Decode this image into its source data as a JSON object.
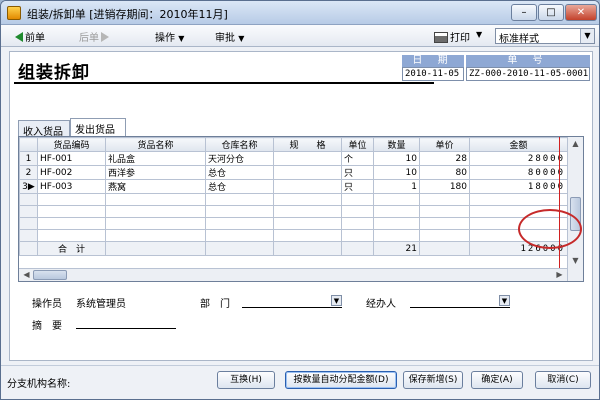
{
  "window": {
    "title": "组装/拆卸单 [进销存期间：2010年11月]",
    "min_label": "–",
    "max_label": "□",
    "close_label": "✕"
  },
  "toolbar": {
    "prev_label": "前单",
    "next_label": "后单",
    "operate_label": "操作",
    "approve_label": "审批",
    "print_label": "打印",
    "mode_value": "标准样式"
  },
  "doc": {
    "title": "组装拆卸",
    "date_label": "日 期",
    "date_value": "2010-11-05",
    "number_label": "单 号",
    "number_value": "ZZ-000-2010-11-05-0001"
  },
  "tabs": [
    {
      "label": "收入货品"
    },
    {
      "label": "发出货品"
    }
  ],
  "grid": {
    "columns": [
      "货品编码",
      "货品名称",
      "仓库名称",
      "规　　格",
      "单位",
      "数量",
      "单价",
      "金额"
    ],
    "rows": [
      {
        "no": "1",
        "code": "HF-001",
        "name": "礼品盒",
        "warehouse": "天河分仓",
        "spec": "",
        "unit": "个",
        "qty": "10",
        "price": "28",
        "amount": "28000"
      },
      {
        "no": "2",
        "code": "HF-002",
        "name": "西洋参",
        "warehouse": "总仓",
        "spec": "",
        "unit": "只",
        "qty": "10",
        "price": "80",
        "amount": "80000"
      },
      {
        "no": "3",
        "code": "HF-003",
        "name": "燕窝",
        "warehouse": "总仓",
        "spec": "",
        "unit": "只",
        "qty": "1",
        "price": "180",
        "amount": "18000"
      }
    ],
    "total": {
      "label": "合　计",
      "qty": "21",
      "amount": "126000"
    }
  },
  "form": {
    "operator_label": "操作员",
    "operator_value": "系统管理员",
    "dept_label": "部　门",
    "handler_label": "经办人",
    "memo_label": "摘　要"
  },
  "footer": {
    "branch_label": "分支机构名称:",
    "swap_label": "互换(H)",
    "auto_alloc_label": "按数量自动分配金额(D)",
    "save_new_label": "保存新增(S)",
    "ok_label": "确定(A)",
    "cancel_label": "取消(C)"
  }
}
